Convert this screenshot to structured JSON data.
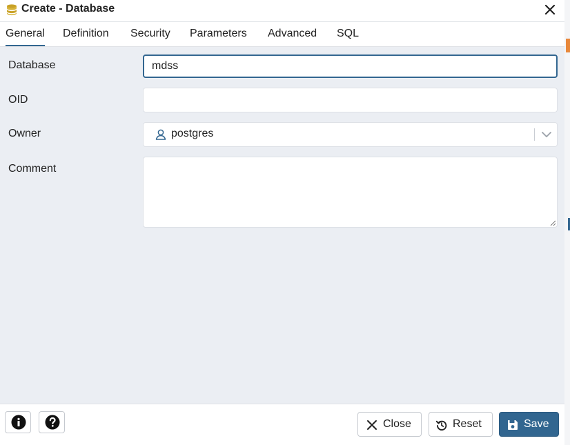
{
  "dialog": {
    "title": "Create - Database",
    "icon": "database-icon"
  },
  "tabs": [
    {
      "label": "General",
      "active": true
    },
    {
      "label": "Definition"
    },
    {
      "label": "Security"
    },
    {
      "label": "Parameters"
    },
    {
      "label": "Advanced"
    },
    {
      "label": "SQL"
    }
  ],
  "form": {
    "database": {
      "label": "Database",
      "value": "mdss"
    },
    "oid": {
      "label": "OID",
      "value": ""
    },
    "owner": {
      "label": "Owner",
      "value": "postgres"
    },
    "comment": {
      "label": "Comment",
      "value": ""
    }
  },
  "footer": {
    "close_label": "Close",
    "reset_label": "Reset",
    "save_label": "Save"
  },
  "colors": {
    "accent": "#326690",
    "background": "#ebeef3"
  }
}
